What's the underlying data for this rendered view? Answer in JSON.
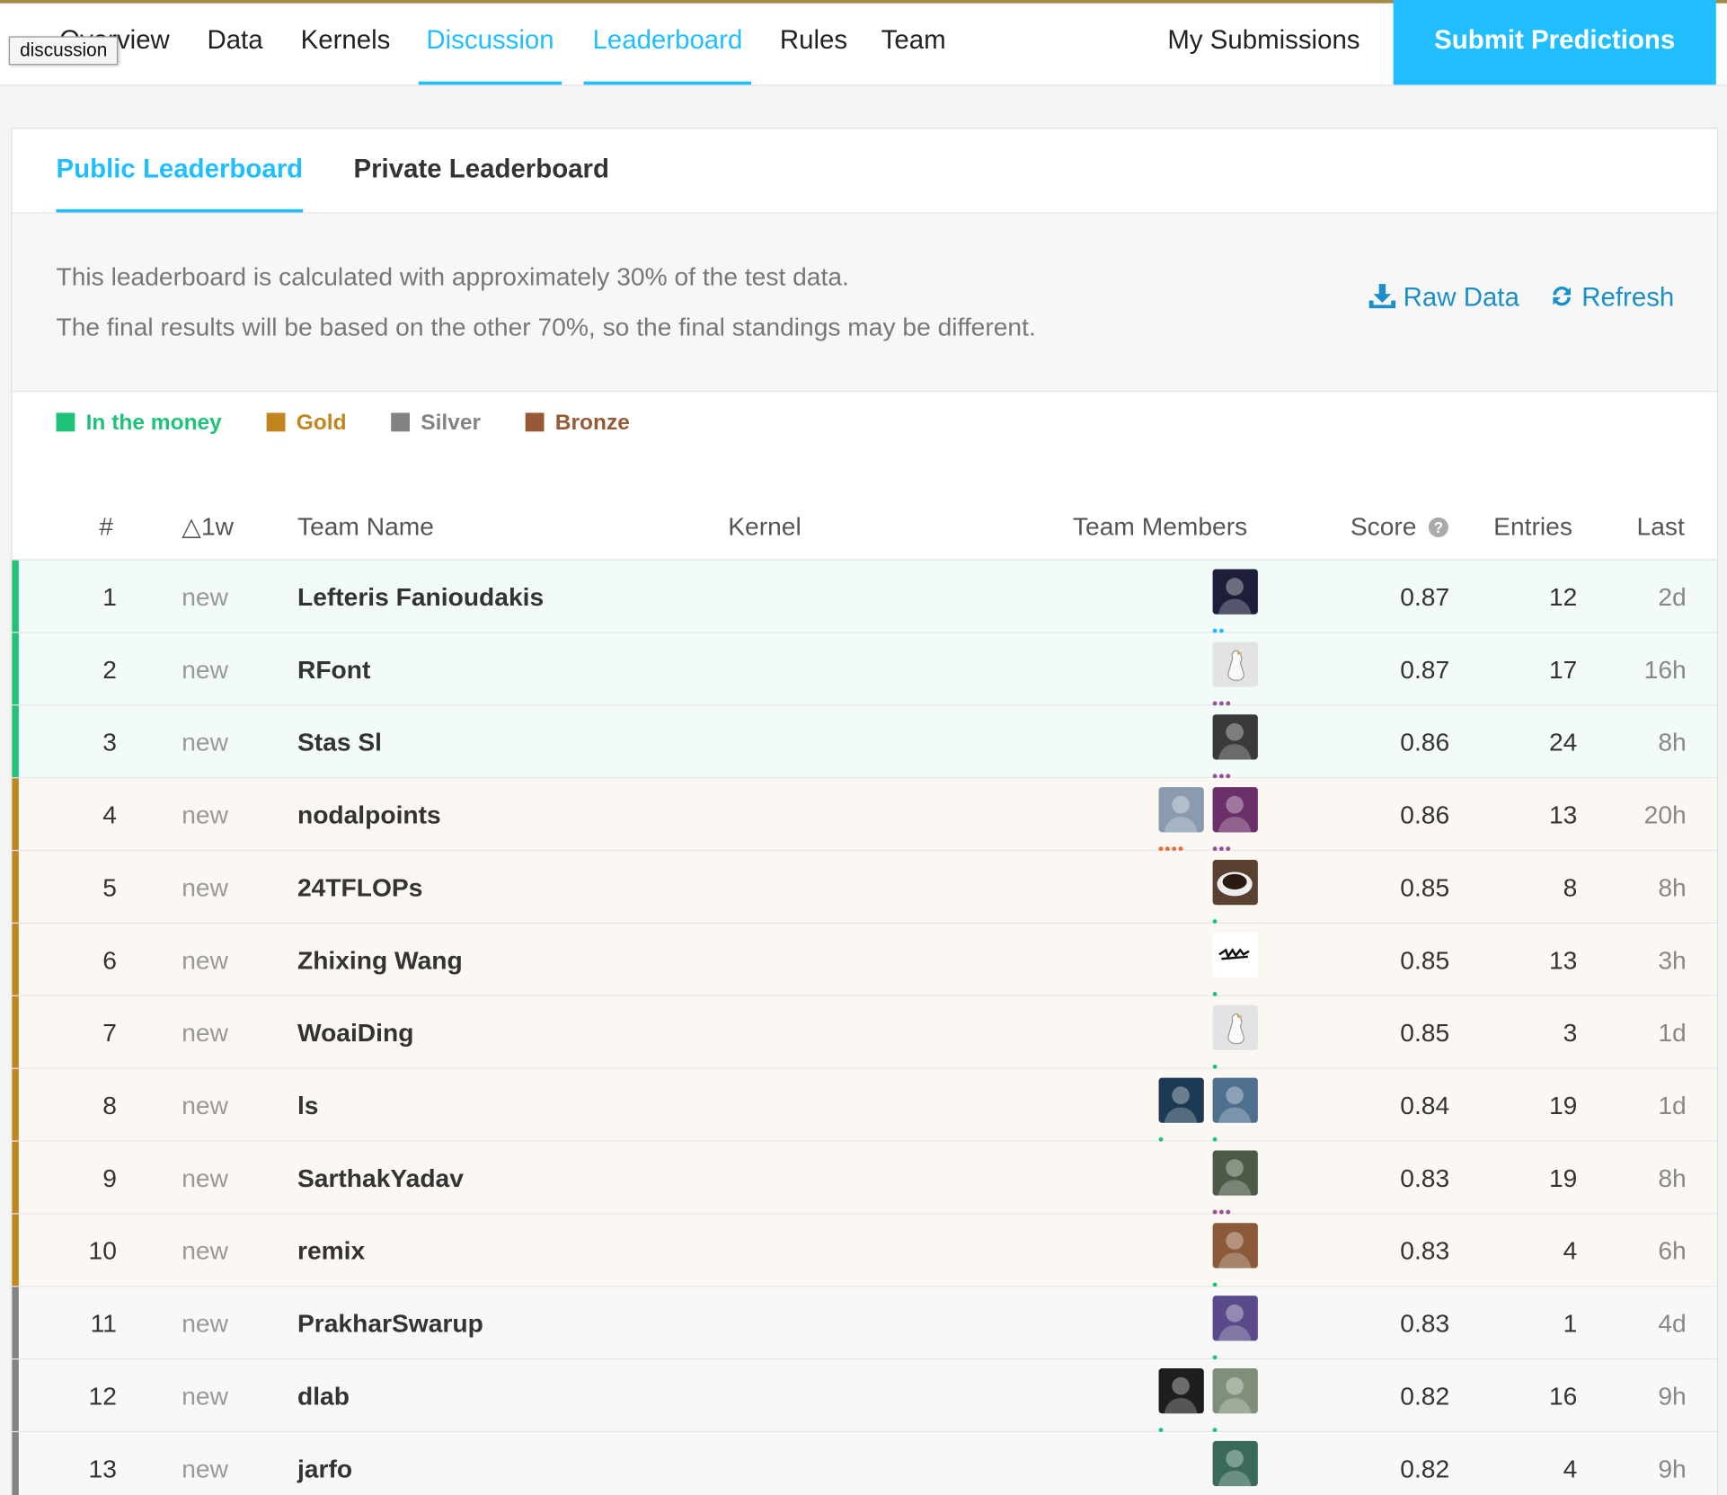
{
  "nav": {
    "tabs": [
      "Overview",
      "Data",
      "Kernels",
      "Discussion",
      "Leaderboard",
      "Rules",
      "Team"
    ],
    "tooltip": "discussion",
    "my_submissions": "My Submissions",
    "submit": "Submit Predictions"
  },
  "subtabs": {
    "public": "Public Leaderboard",
    "private": "Private Leaderboard"
  },
  "info": {
    "line1": "This leaderboard is calculated with approximately 30% of the test data.",
    "line2": "The final results will be based on the other 70%, so the final standings may be different.",
    "raw_data": "Raw Data",
    "refresh": "Refresh"
  },
  "legend": [
    {
      "label": "In the money",
      "color": "#20c27a"
    },
    {
      "label": "Gold",
      "color": "#c2861f"
    },
    {
      "label": "Silver",
      "color": "#838383"
    },
    {
      "label": "Bronze",
      "color": "#965b36"
    }
  ],
  "columns": {
    "rank": "#",
    "delta": "△1w",
    "team": "Team Name",
    "kernel": "Kernel",
    "members": "Team Members",
    "score": "Score",
    "entries": "Entries",
    "last": "Last"
  },
  "colors": {
    "accent": "#20beff",
    "link": "#1a8fc9",
    "money_bar": "#20c27a",
    "gold_bar": "#c2861f",
    "silver_bar": "#838383",
    "money_bg": "#f2fbf8",
    "gold_bg": "#fbf8f3",
    "silver_bg": "#f8f8f8"
  },
  "rows": [
    {
      "rank": "1",
      "delta": "new",
      "team": "Lefteris Fanioudakis",
      "score": "0.87",
      "entries": "12",
      "last": "2d",
      "tier": "money",
      "members": [
        {
          "avatar": "avatar-dark-figure",
          "color": "#1c1e3a",
          "dots": "#20beff",
          "dot_count": 2
        }
      ]
    },
    {
      "rank": "2",
      "delta": "new",
      "team": "RFont",
      "score": "0.87",
      "entries": "17",
      "last": "16h",
      "tier": "money",
      "members": [
        {
          "avatar": "avatar-goose",
          "color": "#e3e3e3",
          "dots": "#9b4f96",
          "dot_count": 3
        }
      ]
    },
    {
      "rank": "3",
      "delta": "new",
      "team": "Stas Sl",
      "score": "0.86",
      "entries": "24",
      "last": "8h",
      "tier": "money",
      "members": [
        {
          "avatar": "avatar-portrait",
          "color": "#3a3a3a",
          "dots": "#9b4f96",
          "dot_count": 3
        }
      ]
    },
    {
      "rank": "4",
      "delta": "new",
      "team": "nodalpoints",
      "score": "0.86",
      "entries": "13",
      "last": "20h",
      "tier": "gold",
      "members": [
        {
          "avatar": "avatar-painting",
          "color": "#8a9bb0",
          "dots": "#f06d3a",
          "dot_count": 4
        },
        {
          "avatar": "avatar-pixel-pirate",
          "color": "#6b2f6a",
          "dots": "#9b4f96",
          "dot_count": 3
        }
      ]
    },
    {
      "rank": "5",
      "delta": "new",
      "team": "24TFLOPs",
      "score": "0.85",
      "entries": "8",
      "last": "8h",
      "tier": "gold",
      "members": [
        {
          "avatar": "avatar-coffee",
          "color": "#5a4030",
          "dots": "#20c27a",
          "dot_count": 1
        }
      ]
    },
    {
      "rank": "6",
      "delta": "new",
      "team": "Zhixing Wang",
      "score": "0.85",
      "entries": "13",
      "last": "3h",
      "tier": "gold",
      "members": [
        {
          "avatar": "avatar-calligraphy",
          "color": "#ffffff",
          "dots": "#20c27a",
          "dot_count": 1
        }
      ]
    },
    {
      "rank": "7",
      "delta": "new",
      "team": "WoaiDing",
      "score": "0.85",
      "entries": "3",
      "last": "1d",
      "tier": "gold",
      "members": [
        {
          "avatar": "avatar-goose",
          "color": "#e3e3e3",
          "dots": "#20c27a",
          "dot_count": 1
        }
      ]
    },
    {
      "rank": "8",
      "delta": "new",
      "team": "ls",
      "score": "0.84",
      "entries": "19",
      "last": "1d",
      "tier": "gold",
      "members": [
        {
          "avatar": "avatar-hooded",
          "color": "#1d3a55",
          "dots": "#20c27a",
          "dot_count": 1
        },
        {
          "avatar": "avatar-penguins",
          "color": "#4f6f8f",
          "dots": "#20c27a",
          "dot_count": 1
        }
      ]
    },
    {
      "rank": "9",
      "delta": "new",
      "team": "SarthakYadav",
      "score": "0.83",
      "entries": "19",
      "last": "8h",
      "tier": "gold",
      "members": [
        {
          "avatar": "avatar-portrait",
          "color": "#4b5b48",
          "dots": "#9b4f96",
          "dot_count": 3
        }
      ]
    },
    {
      "rank": "10",
      "delta": "new",
      "team": "remix",
      "score": "0.83",
      "entries": "4",
      "last": "6h",
      "tier": "gold",
      "members": [
        {
          "avatar": "avatar-animal",
          "color": "#8a5a3a",
          "dots": "#20c27a",
          "dot_count": 1
        }
      ]
    },
    {
      "rank": "11",
      "delta": "new",
      "team": "PrakharSwarup",
      "score": "0.83",
      "entries": "1",
      "last": "4d",
      "tier": "silver",
      "members": [
        {
          "avatar": "avatar-portrait",
          "color": "#5a4a8a",
          "dots": "#20c27a",
          "dot_count": 1
        }
      ]
    },
    {
      "rank": "12",
      "delta": "new",
      "team": "dlab",
      "score": "0.82",
      "entries": "16",
      "last": "9h",
      "tier": "silver",
      "members": [
        {
          "avatar": "avatar-suit",
          "color": "#1e1e1e",
          "dots": "#20c27a",
          "dot_count": 1
        },
        {
          "avatar": "avatar-portrait",
          "color": "#7f8f7a",
          "dots": "#20c27a",
          "dot_count": 1
        }
      ]
    },
    {
      "rank": "13",
      "delta": "new",
      "team": "jarfo",
      "score": "0.82",
      "entries": "4",
      "last": "9h",
      "tier": "silver",
      "members": [
        {
          "avatar": "avatar-portrait",
          "color": "#3a6a5a",
          "dots": "#e8b020",
          "dot_count": 5
        }
      ]
    }
  ]
}
